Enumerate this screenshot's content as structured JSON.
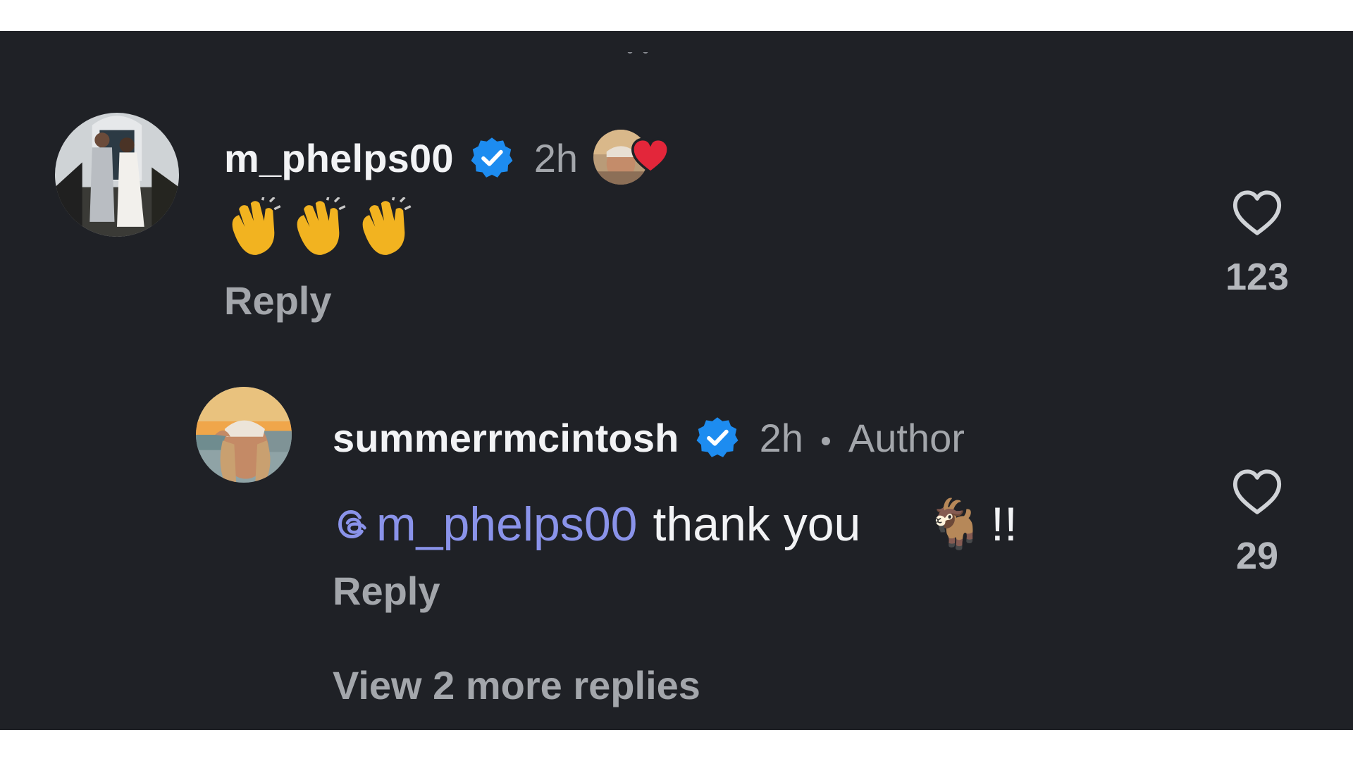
{
  "comments": [
    {
      "username": "m_phelps00",
      "time": "2h",
      "body_emoji": "👏👏👏",
      "reply_label": "Reply",
      "like_count": "123",
      "liked_by_author": true
    },
    {
      "username": "summerrmcintosh",
      "time": "2h",
      "role": "Author",
      "mention": "m_phelps00",
      "text": "thank you",
      "emoji": "🐐",
      "suffix": "!!",
      "reply_label": "Reply",
      "like_count": "29"
    }
  ],
  "view_more_label": "View 2 more replies",
  "colors": {
    "background": "#1f2126",
    "verified": "#1d8cf0",
    "mention": "#8a93ea",
    "heart_liked": "#e3263a",
    "muted_text": "#a3a6ab"
  },
  "icons": [
    "verified-badge-icon",
    "heart-icon",
    "creator-liked-heart-icon",
    "threads-mention-icon",
    "clap-emoji-icon",
    "goat-emoji-icon"
  ]
}
